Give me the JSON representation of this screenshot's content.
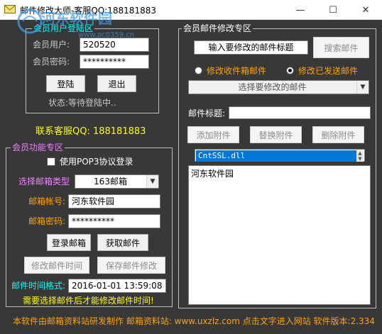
{
  "window": {
    "title": "邮件修改大师-客服QQ:188181883",
    "minimize_glyph": "—",
    "maximize_glyph": "☐",
    "close_glyph": "✕"
  },
  "watermark": {
    "text": "河东软件园",
    "url": "www.pc0359.cn"
  },
  "login_group": {
    "title": "会员用户登陆区",
    "user_label": "会员用户:",
    "user_value": "520520",
    "password_label": "会员密码:",
    "password_value": "**********",
    "login_button": "登陆",
    "logout_button": "退出",
    "status": "状态:等待登陆中.."
  },
  "contact": "联系客服QQ: 188181883",
  "function_group": {
    "title": "会员功能专区",
    "pop3_label": "使用POP3协议登录",
    "mailbox_type_label": "选择邮箱类型",
    "mailbox_type_value": "163邮箱",
    "account_label": "邮箱帐号:",
    "account_value": "河东软件园",
    "password_label": "邮箱密码:",
    "password_value": "**********",
    "login_mailbox_button": "登录邮箱",
    "fetch_mail_button": "获取邮件",
    "modify_time_button": "修改邮件时间",
    "save_modify_button": "保存邮件修改",
    "time_format_label": "邮件时间格式:",
    "time_value": "2016-01-01 13:59:08",
    "warning": "需要选择邮件后才能修改邮件时间!"
  },
  "modify_group": {
    "title": "会员邮件修改专区",
    "subject_search_value": "输入要修改的邮件标题",
    "search_button": "搜索邮件",
    "radio_inbox": "修改收件箱邮件",
    "radio_sent": "修改已发送邮件",
    "select_mail_value": "选择要修改的邮件",
    "mail_subject_label": "邮件标题:",
    "add_attachment_button": "添加附件",
    "replace_attachment_button": "替换附件",
    "delete_attachment_button": "删除附件",
    "attachment_item": "CntSSL.dll",
    "body_text": "河东软件园"
  },
  "footer": "本软件由邮箱资料站研发制作 邮箱资料站: www.uxzlz.com 点击文字进入网站 软件版本:2.334",
  "colors": {
    "background": "#383838",
    "label_gray": "#c8c8c8",
    "label_orange": "#ffa200",
    "label_magenta": "#f080ff",
    "label_yellow": "#ffff00",
    "label_cyan": "#00ffff",
    "selection_blue": "#0078d7"
  },
  "icons": [
    "mail-icon",
    "minimize-icon",
    "maximize-icon",
    "close-icon",
    "chevron-down-icon"
  ]
}
